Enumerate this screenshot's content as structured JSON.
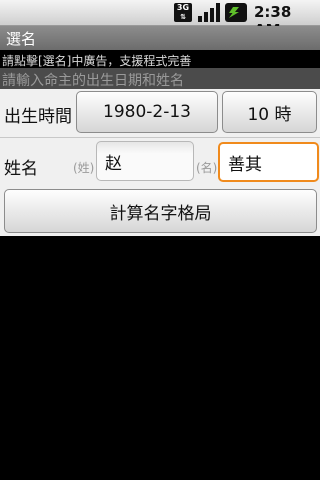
{
  "status": {
    "network": "3G",
    "time": "2:38 AM",
    "icons": [
      "3g-icon",
      "signal-icon",
      "battery-charging-icon"
    ]
  },
  "titlebar": {
    "title": "選名"
  },
  "ad": {
    "text": "請點擊[選名]中廣告，支援程式完善"
  },
  "prompt": {
    "text": "請輸入命主的出生日期和姓名"
  },
  "birth": {
    "label": "出生時間",
    "date_value": "1980-2-13",
    "hour_value": "10 時"
  },
  "name": {
    "label": "姓名",
    "surname_hint": "(姓)",
    "surname_value": "赵",
    "given_hint": "(名)",
    "given_value": "善其"
  },
  "actions": {
    "calculate_label": "計算名字格局"
  },
  "colors": {
    "focus": "#f08a1c",
    "titlebar": "#7a7a7a"
  }
}
